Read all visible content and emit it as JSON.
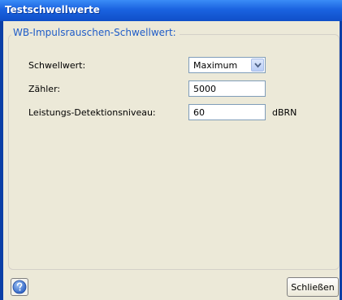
{
  "window": {
    "title": "Testschwellwerte"
  },
  "group": {
    "title": "WB-Impulsrauschen-Schwellwert:"
  },
  "fields": {
    "threshold": {
      "label": "Schwellwert:",
      "value": "Maximum"
    },
    "counter": {
      "label": "Zähler:",
      "value": "5000"
    },
    "power_level": {
      "label": "Leistungs-Detektionsniveau:",
      "value": "60",
      "unit": "dBRN"
    }
  },
  "buttons": {
    "help_icon": "help-icon",
    "close_label": "Schließen"
  },
  "colors": {
    "titlebar": "#1a62e0",
    "group_title": "#1f5cc8",
    "background": "#ece9d8"
  }
}
